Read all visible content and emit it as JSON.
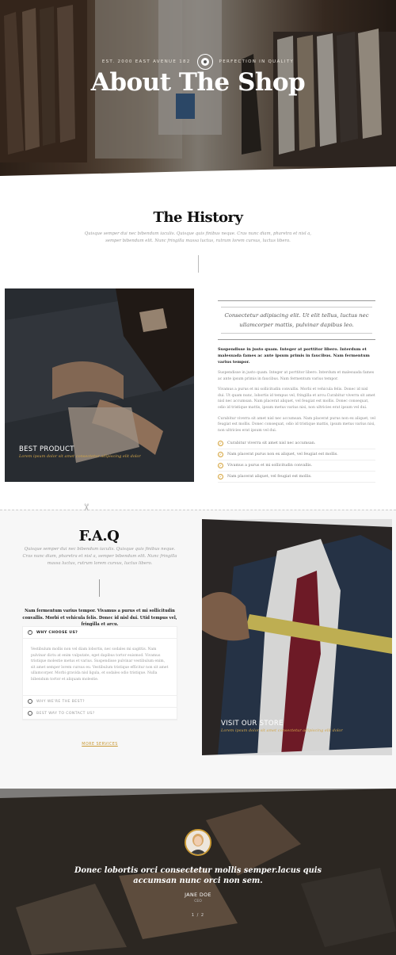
{
  "hero": {
    "meta_left": "EST. 2000 EAST AVENUE 182",
    "meta_right": "PERFECTION IN QUALITY",
    "title": "About The Shop"
  },
  "history": {
    "title": "The History",
    "subtitle": "Quisque semper dui nec bibendum iaculis. Quisque quis finibus neque. Cras nunc diam, pharetra et nisl a, semper bibendum elit. Nunc fringilla massa luctus, rutrum lorem cursus, luctus libero.",
    "photo_caption_title": "BEST PRODUCT",
    "photo_caption_sub": "Lorem ipsum dolor sit amet consectetur adipiscing elit dolor",
    "quote": "Consectetur adipiscing elit. Ut elit tellus, luctus nec ullamcorper mattis, pulvinar dapibus leo.",
    "bold_paragraph": "Suspendisse in justo quam. Integer at porttitor libero. Interdum et malesuada fames ac ante ipsum primis in faucibus. Nam fermentum varius tempor.",
    "paragraph1": "Suspendisse in justo quam. Integer at porttitor libero. Interdum et malesuada fames ac ante ipsum primis in faucibus. Nam fermentum varius tempor.",
    "paragraph2": "Vivamus a purus et mi sollicitudin convallis. Morbi et vehicula felis. Donec id nisl dui. Ut quam nunc, lobortis id tempus vel, fringilla et arcu.Curabitur viverra sit amet nisl nec accumsan. Nam placerat aliquet, vel feugiat est mollis. Donec consequat, odio id tristique mattis, ipsum metus varius nisi, non ultricies erat ipsum vel dui.",
    "paragraph3": "Curabitur viverra sit amet nisl nec accumsan. Nam placerat purus non ex aliquet, vel feugiat est mollis. Donec consequat, odio id tristique mattis, ipsum metus varius nisi, non ultricies erat ipsum vel dui.",
    "list": [
      "Curabitur viverra sit amet nisl nec accumsan.",
      "Nam placerat purus non ex aliquet, vel feugiat est mollis.",
      "Vivamus a purus et mi sollicitudin convallis.",
      "Nam placerat aliquet, vel feugiat est mollis."
    ]
  },
  "faq": {
    "title": "F.A.Q",
    "subtitle": "Quisque semper dui nec bibendum iaculis. Quisque quis finibus neque. Cras nunc diam, pharetra et nisl a, semper bibendum elit. Nunc fringilla massa luctus, rutrum lorem cursus, luctus libero.",
    "lead": "Nam fermentum varius tempor. Vivamus a purus et mi sollicitudin convallis. Morbi et vehicula felis. Donec id nisl dui. Utid tempus vel, fringilla et arcu.",
    "items": [
      {
        "label": "WHY CHOOSE US?",
        "open": true,
        "body": "Vestibulum mollis non vel diam lobortis, nec sodales mi sagittis. Nam pulvinar dictu at enim vulputate, eget dapibus tortor euismod. Vivamus tristique molestie metus et varius. Suspendisse pulvinar vestibulum enim, sit amet semper lorem cursus eu. Vestibulum tristique efficitur non sit amet ullamcorper. Morbi gravida nisl ligula, et sodales odio tristique. Nulla bibendum tortor et aliquam molestie."
      },
      {
        "label": "WHY WE'RE THE BEST?",
        "open": false
      },
      {
        "label": "BEST WAY TO CONTACT US?",
        "open": false
      }
    ],
    "more_link": "MORE SERVICES",
    "photo_caption_title": "VISIT OUR STORE",
    "photo_caption_sub": "Lorem ipsum dolor sit amet consectetur adipiscing elit dolor"
  },
  "testimonial": {
    "quote": "Donec lobortis orci consectetur mollis semper.lacus quis accumsan nunc orci non sem.",
    "name": "JANE DOE",
    "role": "CEO",
    "pager": "1 / 2"
  },
  "colors": {
    "accent": "#c99a36",
    "dark": "#111111",
    "muted": "#999999"
  }
}
